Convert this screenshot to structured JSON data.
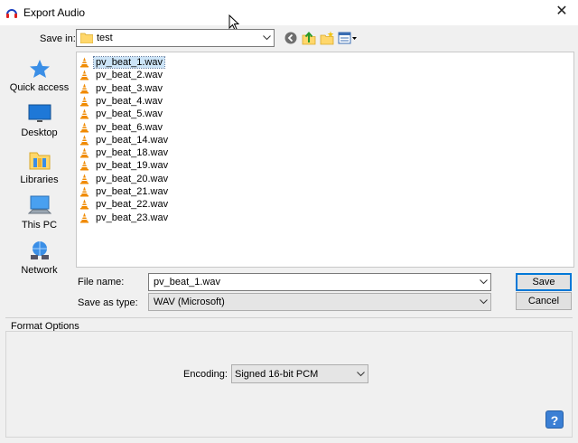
{
  "window": {
    "title": "Export Audio",
    "close_glyph": "✕"
  },
  "save_in": {
    "label": "Save in:",
    "value": "test"
  },
  "toolbar": {
    "back_icon": "back-icon",
    "up_icon": "up-folder-icon",
    "new_folder_icon": "new-folder-icon",
    "view_icon": "view-menu-icon"
  },
  "places": [
    {
      "label": "Quick access",
      "icon": "star-icon"
    },
    {
      "label": "Desktop",
      "icon": "desktop-icon"
    },
    {
      "label": "Libraries",
      "icon": "libraries-icon"
    },
    {
      "label": "This PC",
      "icon": "computer-icon"
    },
    {
      "label": "Network",
      "icon": "network-icon"
    }
  ],
  "files": [
    "pv_beat_1.wav",
    "pv_beat_2.wav",
    "pv_beat_3.wav",
    "pv_beat_4.wav",
    "pv_beat_5.wav",
    "pv_beat_6.wav",
    "pv_beat_14.wav",
    "pv_beat_18.wav",
    "pv_beat_19.wav",
    "pv_beat_20.wav",
    "pv_beat_21.wav",
    "pv_beat_22.wav",
    "pv_beat_23.wav"
  ],
  "selected_file_index": 0,
  "file_name": {
    "label": "File name:",
    "value": "pv_beat_1.wav"
  },
  "save_as_type": {
    "label": "Save as type:",
    "value": "WAV (Microsoft)"
  },
  "buttons": {
    "save": "Save",
    "cancel": "Cancel"
  },
  "format_options": {
    "title": "Format Options",
    "encoding_label": "Encoding:",
    "encoding_value": "Signed 16-bit PCM"
  },
  "help": {
    "glyph": "?"
  },
  "colors": {
    "accent": "#0078d7",
    "selection": "#cce4f7",
    "vlc_orange": "#f08a00"
  }
}
